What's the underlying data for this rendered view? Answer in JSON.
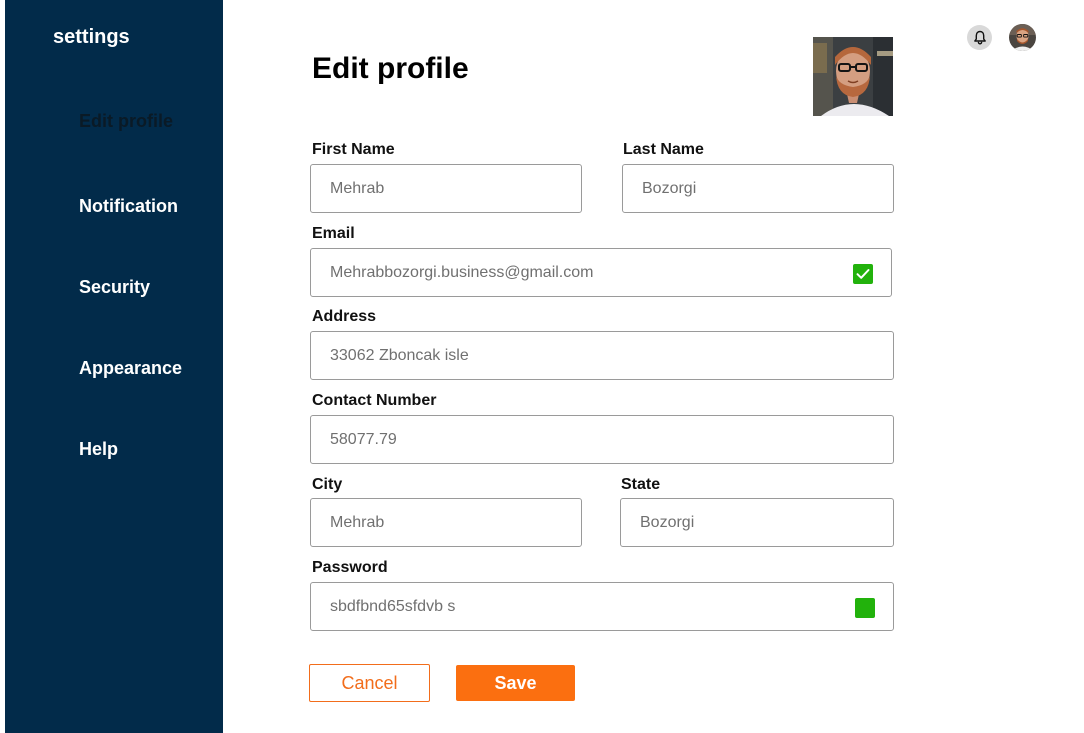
{
  "sidebar": {
    "title": "settings",
    "items": [
      {
        "label": "Edit profile",
        "active": true
      },
      {
        "label": "Notification"
      },
      {
        "label": "Security"
      },
      {
        "label": "Appearance"
      },
      {
        "label": "Help"
      }
    ]
  },
  "main": {
    "title": "Edit profile",
    "form": {
      "first_name": {
        "label": "First Name",
        "value": "Mehrab"
      },
      "last_name": {
        "label": "Last Name",
        "value": "Bozorgi"
      },
      "email": {
        "label": "Email",
        "value": "Mehrabbozorgi.business@gmail.com",
        "verified": true
      },
      "address": {
        "label": "Address",
        "value": "33062 Zboncak isle"
      },
      "contact_number": {
        "label": "Contact Number",
        "value": "58077.79"
      },
      "city": {
        "label": "City",
        "value": "Mehrab"
      },
      "state": {
        "label": "State",
        "value": "Bozorgi"
      },
      "password": {
        "label": "Password",
        "value": "sbdfbnd65sfdvb s"
      }
    },
    "actions": {
      "cancel_label": "Cancel",
      "save_label": "Save"
    }
  },
  "icons": {
    "notification": "bell-icon",
    "user": "avatar",
    "verified": "checkmark-icon"
  },
  "colors": {
    "sidebar_bg": "#022b4a",
    "accent": "#fb6f10",
    "success": "#22b20c",
    "field_border": "#9a9a9a",
    "field_text": "#707070"
  }
}
